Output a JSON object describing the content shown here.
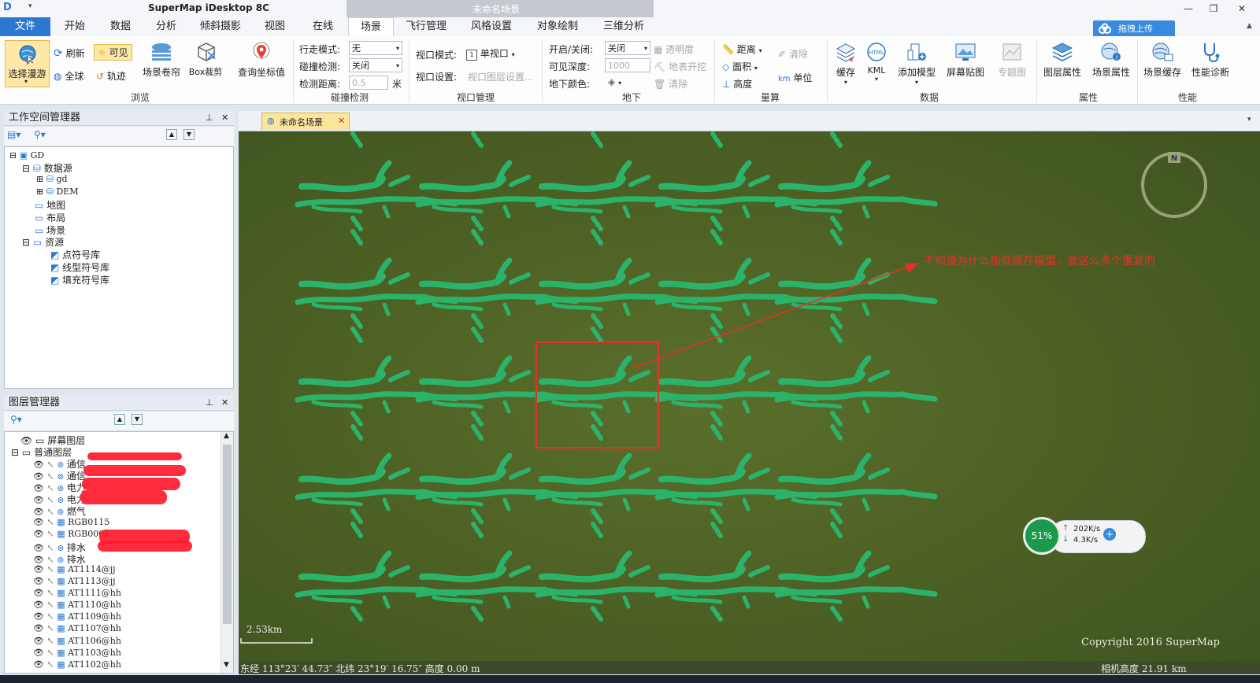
{
  "app": {
    "title": "SuperMap iDesktop 8C",
    "context_title": "未命名场景",
    "upload_button": "拖拽上传"
  },
  "tabs": [
    {
      "label": "文件",
      "state": "file"
    },
    {
      "label": "开始"
    },
    {
      "label": "数据"
    },
    {
      "label": "分析"
    },
    {
      "label": "倾斜摄影"
    },
    {
      "label": "视图"
    },
    {
      "label": "在线"
    },
    {
      "label": "场景",
      "state": "active"
    },
    {
      "label": "飞行管理"
    },
    {
      "label": "风格设置"
    },
    {
      "label": "对象绘制"
    },
    {
      "label": "三维分析"
    }
  ],
  "ribbon": {
    "browse": {
      "group": "浏览",
      "select_roam": "选择漫游",
      "refresh": "刷新",
      "visible": "可见",
      "full_globe": "全球",
      "track": "轨迹",
      "scene_shutter": "场景卷帘",
      "box_clip": "Box裁剪",
      "query_coords": "查询坐标值"
    },
    "collision": {
      "group": "碰撞检测",
      "walk_mode_label": "行走模式:",
      "walk_mode_value": "无",
      "collision_label": "碰撞检测:",
      "collision_value": "关闭",
      "distance_label": "检测距离:",
      "distance_value": "0.5",
      "distance_unit": "米"
    },
    "viewport": {
      "group": "视口管理",
      "mode_label": "视口模式:",
      "mode_value": "单视口",
      "settings_label": "视口设置:",
      "settings_value": "视口图层设置..."
    },
    "underground": {
      "group": "地下",
      "toggle_label": "开启/关闭:",
      "toggle_value": "关闭",
      "depth_label": "可见深度:",
      "depth_value": "1000",
      "color_label": "地下颜色:",
      "transparency": "透明度",
      "surface_dig": "地表开挖",
      "clear": "清除"
    },
    "measure": {
      "group": "量算",
      "distance": "距离",
      "area": "面积",
      "height": "高度",
      "clear": "清除",
      "unit": "单位"
    },
    "data": {
      "group": "数据",
      "cache": "缓存",
      "kml": "KML",
      "add_model": "添加模型",
      "screen_map": "屏幕贴图",
      "thematic": "专题图"
    },
    "properties": {
      "group": "属性",
      "layer_props": "图层属性",
      "scene_props": "场景属性"
    },
    "performance": {
      "group": "性能",
      "scene_cache": "场景缓存",
      "diagnosis": "性能诊断"
    }
  },
  "workspace": {
    "title": "工作空间管理器",
    "items": [
      {
        "label": "GD"
      },
      {
        "label": "数据源"
      },
      {
        "label": "gd"
      },
      {
        "label": "DEM"
      },
      {
        "label": "地图"
      },
      {
        "label": "布局"
      },
      {
        "label": "场景"
      },
      {
        "label": "资源"
      },
      {
        "label": "点符号库"
      },
      {
        "label": "线型符号库"
      },
      {
        "label": "填充符号库"
      }
    ]
  },
  "layers": {
    "title": "图层管理器",
    "screen_layer": "屏幕图层",
    "normal_layer": "普通图层",
    "items": [
      "通信",
      "通信",
      "电力",
      "电力",
      "燃气",
      "RGB0115",
      "RGB0001",
      "排水",
      "排水",
      "AT1114@jj",
      "AT1113@jj",
      "AT1111@hh",
      "AT1110@hh",
      "AT1109@hh",
      "AT1107@hh",
      "AT1106@hh",
      "AT1103@hh",
      "AT1102@hh"
    ]
  },
  "scene": {
    "tab_label": "未命名场景",
    "annotation": "不知道为什么加载缓存模型，会这么多个重复的",
    "compass_label": "N",
    "scale": "2.53km",
    "status_coords": "东经 113°23′ 44.73″  北纬 23°19′ 16.75″  高度 0.00 m",
    "copyright": "Copyright 2016 SuperMap",
    "camera_height": "相机高度 21.91 km",
    "net_percent": "51%",
    "net_up": "202K/s",
    "net_down": "4.3K/s"
  },
  "colors": {
    "scene_bg": "#4a5e25",
    "model_green": "#2bb36a",
    "annotation_red": "#e8302a",
    "accent_blue": "#2b78d0"
  }
}
